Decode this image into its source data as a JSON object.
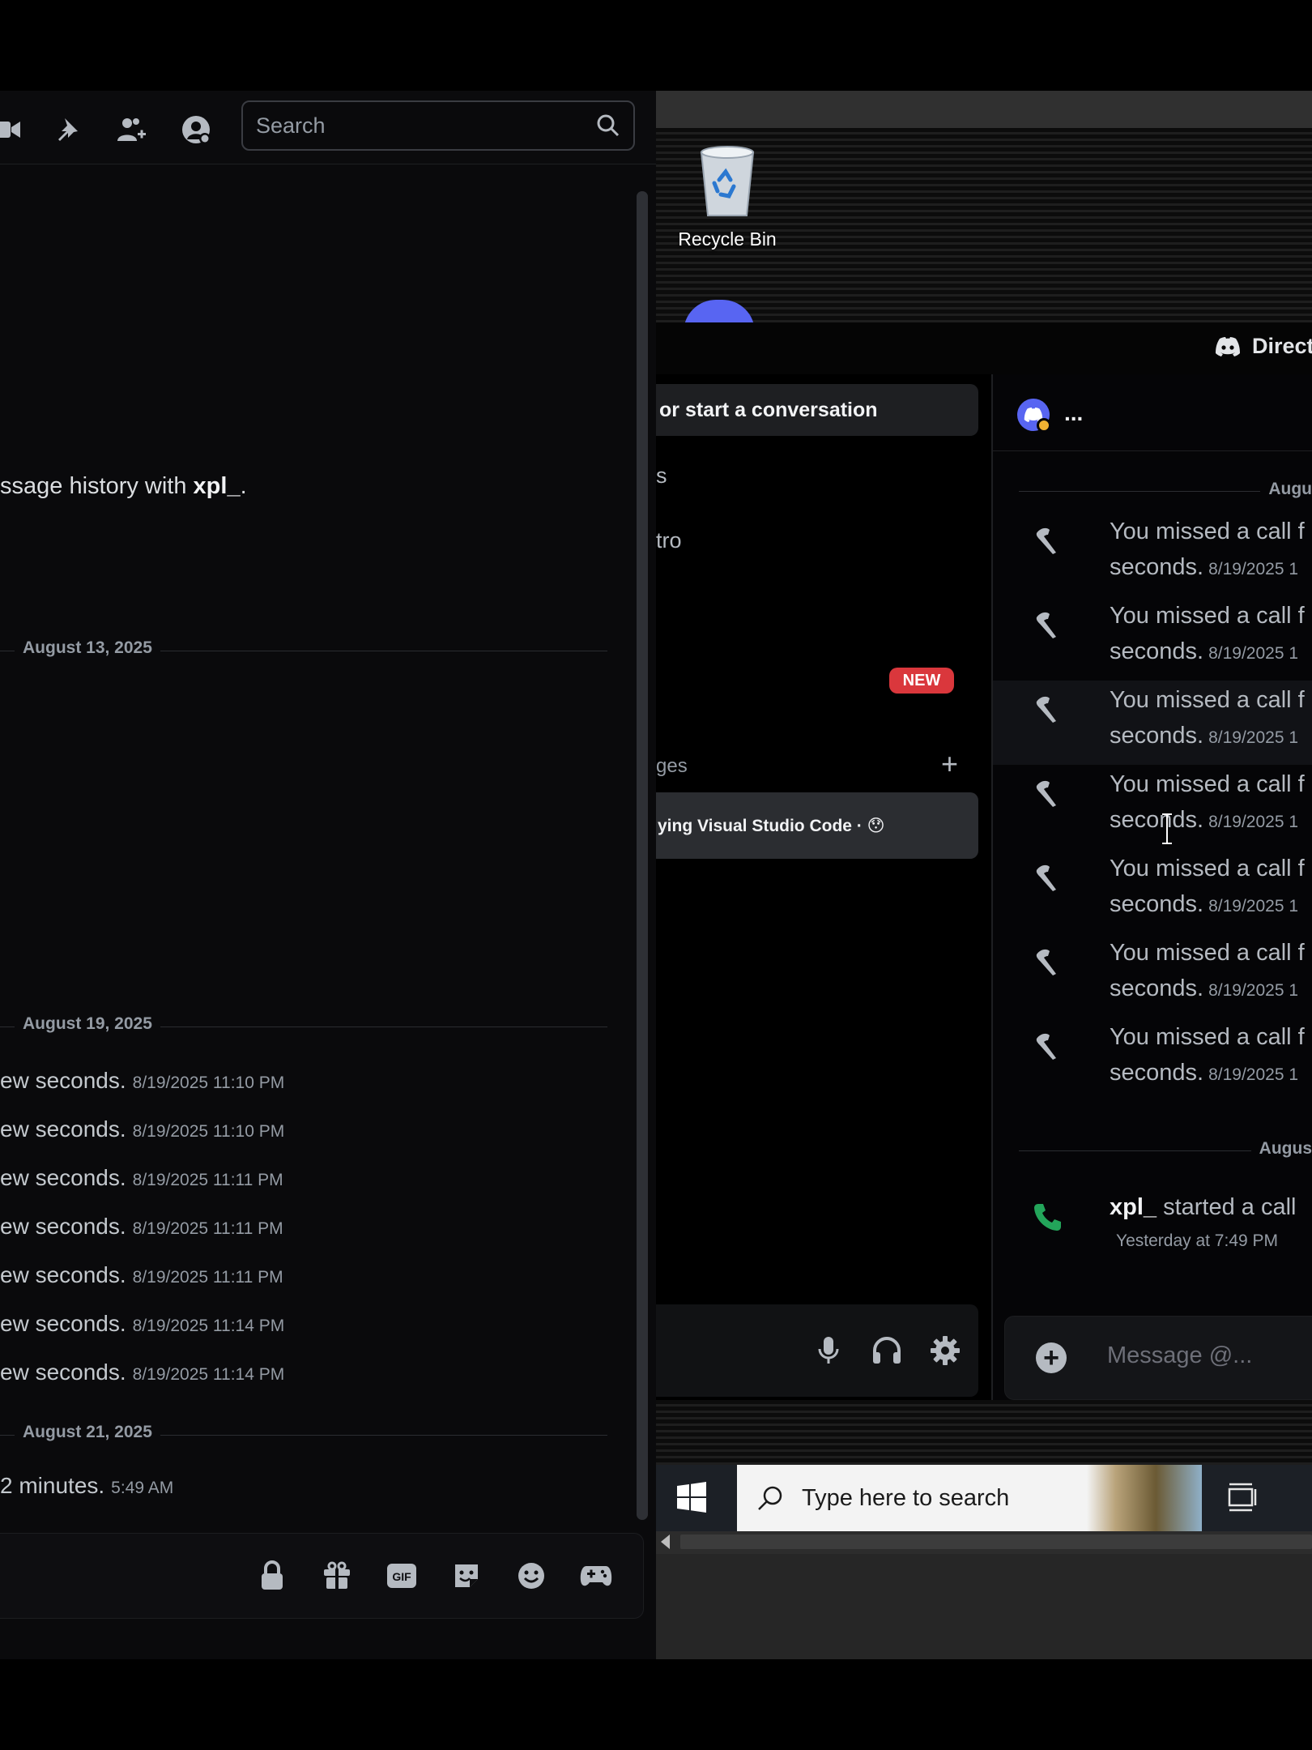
{
  "left": {
    "search": {
      "placeholder": "Search"
    },
    "history": {
      "prefix": "ssage history with ",
      "user": "xpl_",
      "suffix": "."
    },
    "dividers": [
      "August 13, 2025",
      "August 19, 2025",
      "August 21, 2025"
    ],
    "messages": [
      {
        "text": "ew seconds.",
        "time": "8/19/2025 11:10 PM"
      },
      {
        "text": "ew seconds.",
        "time": "8/19/2025 11:10 PM"
      },
      {
        "text": "ew seconds.",
        "time": "8/19/2025 11:11 PM"
      },
      {
        "text": "ew seconds.",
        "time": "8/19/2025 11:11 PM"
      },
      {
        "text": "ew seconds.",
        "time": "8/19/2025 11:11 PM"
      },
      {
        "text": "ew seconds.",
        "time": "8/19/2025 11:14 PM"
      },
      {
        "text": "ew seconds.",
        "time": "8/19/2025 11:14 PM"
      }
    ],
    "last_message": {
      "text": "2 minutes.",
      "time": "5:49 AM"
    },
    "composer_icons": [
      "lock-icon",
      "gift-icon",
      "gif-icon",
      "sticker-icon",
      "emoji-icon",
      "gamepad-icon"
    ]
  },
  "desktop": {
    "recycle_bin": "Recycle Bin",
    "discord": {
      "title": "Direct",
      "find_conversation": "or start a conversation",
      "nav": {
        "item1": "s",
        "item2": "tro"
      },
      "new_badge": "NEW",
      "dm_header": "ges",
      "dm_add": "+",
      "dm_item": "ying Visual Studio Code · 😯",
      "chat": {
        "name": "...",
        "divider_top": "Augu",
        "divider_bottom": "Augus",
        "missed_calls": [
          {
            "line1": "You missed a call f",
            "line2": "seconds.",
            "time": "8/19/2025 1"
          },
          {
            "line1": "You missed a call f",
            "line2": "seconds.",
            "time": "8/19/2025 1"
          },
          {
            "line1": "You missed a call f",
            "line2": "seconds.",
            "time": "8/19/2025 1"
          },
          {
            "line1": "You missed a call f",
            "line2": "seconds.",
            "time": "8/19/2025 1"
          },
          {
            "line1": "You missed a call f",
            "line2": "seconds.",
            "time": "8/19/2025 1"
          },
          {
            "line1": "You missed a call f",
            "line2": "seconds.",
            "time": "8/19/2025 1"
          },
          {
            "line1": "You missed a call f",
            "line2": "seconds.",
            "time": "8/19/2025 1"
          }
        ],
        "call": {
          "user": "xpl_",
          "text": " started a call",
          "time": "Yesterday at 7:49 PM"
        },
        "composer_placeholder": "Message @..."
      }
    },
    "taskbar": {
      "search_placeholder": "Type here to search"
    }
  },
  "colors": {
    "accent": "#5865f2",
    "danger": "#da373c",
    "call_green": "#23a55a",
    "idle": "#f0b232"
  }
}
